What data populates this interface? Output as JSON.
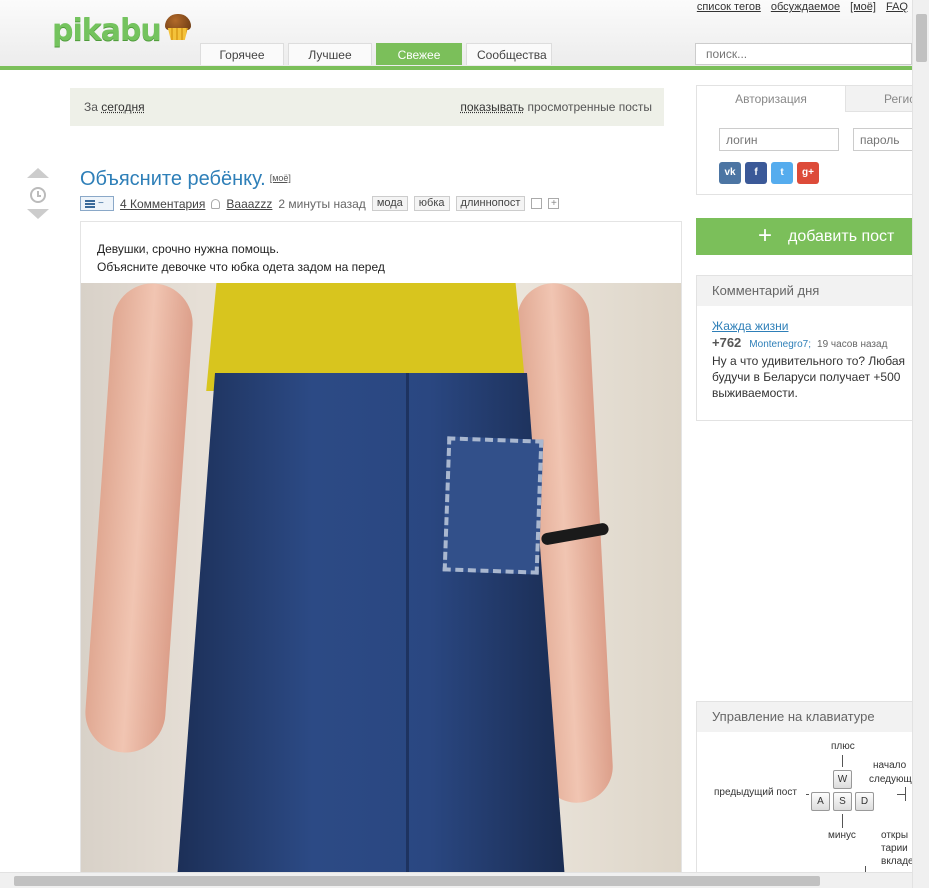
{
  "header": {
    "logo_text": "pikabu",
    "toplinks": [
      "список тегов",
      "обсуждаемое",
      "[моё]",
      "FAQ"
    ],
    "tabs": [
      {
        "label": "Горячее",
        "active": false
      },
      {
        "label": "Лучшее",
        "active": false
      },
      {
        "label": "Свежее",
        "active": true
      },
      {
        "label": "Сообщества",
        "active": false
      }
    ],
    "search_placeholder": "поиск..."
  },
  "filter": {
    "period_prefix": "За",
    "period_value": "сегодня",
    "show_link": "показывать",
    "show_suffix": "просмотренные посты"
  },
  "post": {
    "title": "Объясните ребёнку.",
    "moe": "[моё]",
    "comments": "4 Комментария",
    "author": "Baaazzz",
    "time": "2 минуты назад",
    "tags": [
      "мода",
      "юбка",
      "длиннопост"
    ],
    "text_lines": [
      "Девушки, срочно нужна помощь.",
      "Объясните девочке что юбка одета задом на перед"
    ]
  },
  "sidebar": {
    "auth": {
      "tab_login": "Авторизация",
      "tab_register": "Регистрация",
      "login_placeholder": "логин",
      "password_placeholder": "пароль",
      "socials": [
        "vk",
        "f",
        "t",
        "g+"
      ]
    },
    "add_post": "добавить пост",
    "comment_of_day": {
      "heading": "Комментарий дня",
      "post_link": "Жажда жизни",
      "score": "+762",
      "user": "Montenegro7;",
      "time": "19 часов назад",
      "text_lines": [
        "Ну а что удивительного то? Любая",
        "будучи в Беларуси получает +500",
        "выживаемости."
      ]
    },
    "keyboard": {
      "heading": "Управление на клавиатуре",
      "labels": {
        "plus": "плюс",
        "start": "начало",
        "next": "следующ",
        "prev": "предыдущий пост",
        "minus": "минус",
        "open1": "откры",
        "open2": "тарии",
        "open3": "вкладе"
      },
      "keys": [
        "W",
        "A",
        "S",
        "D"
      ]
    }
  },
  "colors": {
    "brand_green": "#7bbf5a",
    "link_blue": "#2e7fb8"
  }
}
